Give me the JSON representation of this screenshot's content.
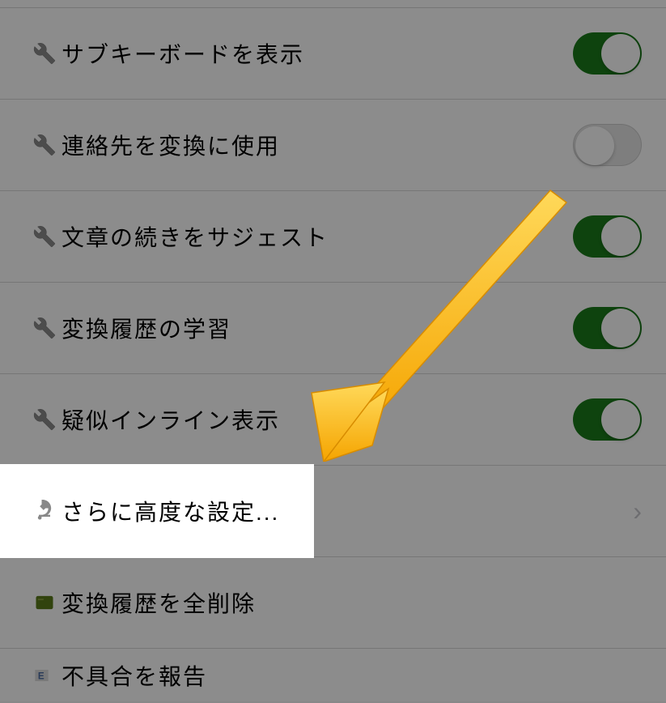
{
  "settings": {
    "rows": [
      {
        "label": "サブキーボードを表示",
        "type": "toggle",
        "state": "on",
        "icon": "wrench"
      },
      {
        "label": "連絡先を変換に使用",
        "type": "toggle",
        "state": "off",
        "icon": "wrench"
      },
      {
        "label": "文章の続きをサジェスト",
        "type": "toggle",
        "state": "on",
        "icon": "wrench"
      },
      {
        "label": "変換履歴の学習",
        "type": "toggle",
        "state": "on",
        "icon": "wrench"
      },
      {
        "label": "疑似インライン表示",
        "type": "toggle",
        "state": "on",
        "icon": "wrench"
      },
      {
        "label": "さらに高度な設定...",
        "type": "link",
        "icon": "microscope"
      },
      {
        "label": "変換履歴を全削除",
        "type": "action",
        "icon": "card"
      },
      {
        "label": "不具合を報告",
        "type": "action",
        "icon": "tag"
      }
    ]
  },
  "highlight": {
    "label": "さらに高度な設定...",
    "row_index": 5
  },
  "colors": {
    "toggle_on": "#1a7a1a",
    "toggle_off": "#e5e5e5",
    "arrow": "#f5b400",
    "overlay": "rgba(0,0,0,0.45)"
  }
}
